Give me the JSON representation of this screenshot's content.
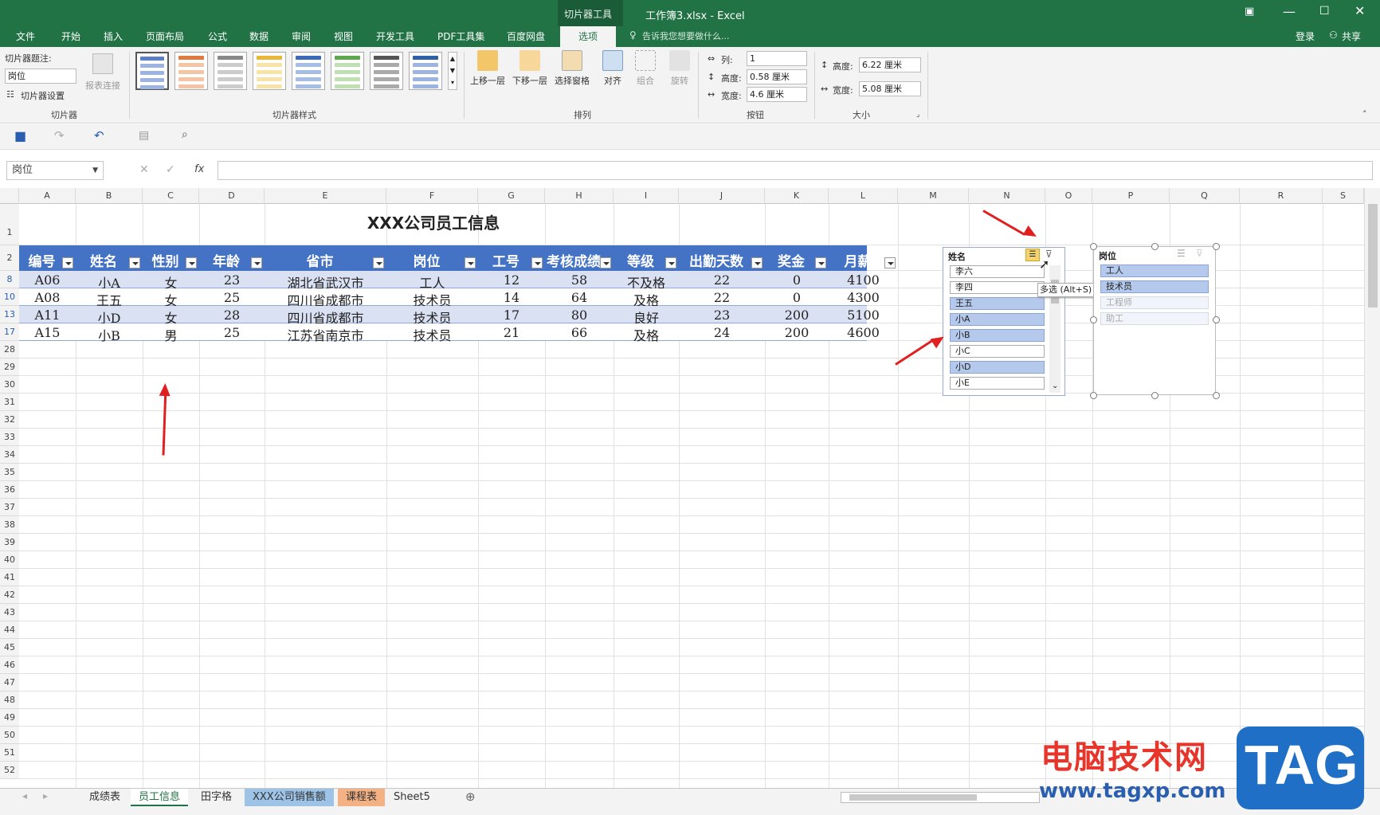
{
  "window": {
    "context_tab": "切片器工具",
    "title": "工作簿3.xlsx - Excel"
  },
  "tabs": [
    "文件",
    "开始",
    "插入",
    "页面布局",
    "公式",
    "数据",
    "审阅",
    "视图",
    "开发工具",
    "PDF工具集",
    "百度网盘",
    "选项"
  ],
  "active_tab": "选项",
  "tell_me": "告诉我您想要做什么...",
  "login": "登录",
  "share": "共享",
  "ribbon": {
    "caption_label": "切片器题注:",
    "caption_value": "岗位",
    "slicer_settings": "切片器设置",
    "report_conn": "报表连接",
    "group_slicer": "切片器",
    "group_styles": "切片器样式",
    "bring_forward": "上移一层",
    "send_backward": "下移一层",
    "selection_pane": "选择窗格",
    "align": "对齐",
    "group": "组合",
    "rotate": "旋转",
    "group_arrange": "排列",
    "columns_label": "列:",
    "columns_value": "1",
    "btn_height_label": "高度:",
    "btn_height_value": "0.58 厘米",
    "btn_width_label": "宽度:",
    "btn_width_value": "4.6 厘米",
    "group_buttons": "按钮",
    "size_height_label": "高度:",
    "size_height_value": "6.22 厘米",
    "size_width_label": "宽度:",
    "size_width_value": "5.08 厘米",
    "group_size": "大小"
  },
  "namebox": "岗位",
  "columns": [
    "A",
    "B",
    "C",
    "D",
    "E",
    "F",
    "G",
    "H",
    "I",
    "J",
    "K",
    "L",
    "M",
    "N",
    "O",
    "P",
    "Q",
    "R",
    "S"
  ],
  "sheet_title": "XXX公司员工信息",
  "table_headers": [
    "编号",
    "姓名",
    "性别",
    "年龄",
    "省市",
    "岗位",
    "工号",
    "考核成绩",
    "等级",
    "出勤天数",
    "奖金",
    "月薪"
  ],
  "rows": [
    {
      "rownum": "8",
      "cells": [
        "A06",
        "小A",
        "女",
        "23",
        "湖北省武汉市",
        "工人",
        "12",
        "58",
        "不及格",
        "22",
        "0",
        "4100"
      ]
    },
    {
      "rownum": "10",
      "cells": [
        "A08",
        "王五",
        "女",
        "25",
        "四川省成都市",
        "技术员",
        "14",
        "64",
        "及格",
        "22",
        "0",
        "4300"
      ]
    },
    {
      "rownum": "13",
      "cells": [
        "A11",
        "小D",
        "女",
        "28",
        "四川省成都市",
        "技术员",
        "17",
        "80",
        "良好",
        "23",
        "200",
        "5100"
      ]
    },
    {
      "rownum": "17",
      "cells": [
        "A15",
        "小B",
        "男",
        "25",
        "江苏省南京市",
        "技术员",
        "21",
        "66",
        "及格",
        "24",
        "200",
        "4600"
      ]
    }
  ],
  "extra_rownums": [
    "28",
    "29",
    "30",
    "31",
    "32",
    "33",
    "34",
    "35",
    "36",
    "37",
    "38",
    "39",
    "40",
    "41",
    "42",
    "43",
    "44",
    "45",
    "46",
    "47",
    "48",
    "49",
    "50",
    "51",
    "52"
  ],
  "slicer_name": {
    "title": "姓名",
    "items": [
      {
        "label": "李六",
        "state": "off"
      },
      {
        "label": "李四",
        "state": "off"
      },
      {
        "label": "王五",
        "state": "on"
      },
      {
        "label": "小A",
        "state": "on"
      },
      {
        "label": "小B",
        "state": "on"
      },
      {
        "label": "小C",
        "state": "off"
      },
      {
        "label": "小D",
        "state": "on"
      },
      {
        "label": "小E",
        "state": "off"
      }
    ],
    "tooltip": "多选 (Alt+S)"
  },
  "slicer_post": {
    "title": "岗位",
    "items": [
      {
        "label": "工人",
        "state": "on"
      },
      {
        "label": "技术员",
        "state": "on"
      },
      {
        "label": "工程师",
        "state": "dim"
      },
      {
        "label": "助工",
        "state": "dim"
      }
    ]
  },
  "sheet_tabs": [
    {
      "label": "成绩表",
      "color": ""
    },
    {
      "label": "员工信息",
      "color": "active"
    },
    {
      "label": "田字格",
      "color": ""
    },
    {
      "label": "XXX公司销售额",
      "color": "#9dc3e6"
    },
    {
      "label": "课程表",
      "color": "#f4b183"
    },
    {
      "label": "Sheet5",
      "color": ""
    }
  ],
  "watermark": {
    "cn": "电脑技术网",
    "url": "www.tagxp.com",
    "logo": "TAG"
  },
  "colors": {
    "excel_green": "#217346",
    "table_header": "#4472c4",
    "band_light": "#d9e1f2",
    "slicer_selected": "#b4c9ec",
    "arrow_red": "#e02020"
  }
}
